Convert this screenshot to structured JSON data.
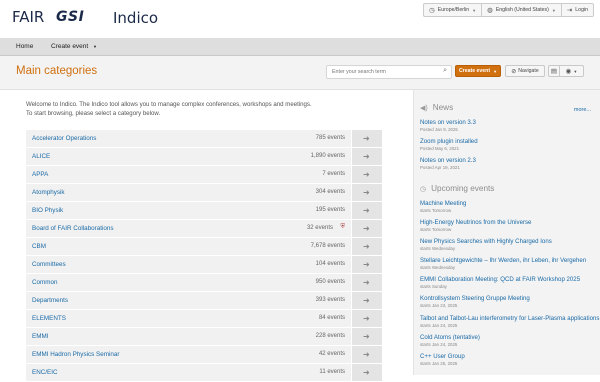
{
  "header": {
    "logo_fair": "FAIR",
    "logo_gsi": "GSI",
    "title": "Indico",
    "top_menu": {
      "timezone": "Europe/Berlin",
      "language": "English (United States)",
      "login": "Login"
    }
  },
  "nav": {
    "home": "Home",
    "create_event": "Create event"
  },
  "page": {
    "title": "Main categories",
    "search_placeholder": "Enter your search term",
    "create_event_button": "Create event",
    "navigate_button": "Navigate"
  },
  "welcome": {
    "line1": "Welcome to Indico. The Indico tool allows you to manage complex conferences, workshops and meetings.",
    "line2": "To start browsing, please select a category below."
  },
  "categories": [
    {
      "name": "Accelerator Operations",
      "count": "785 events"
    },
    {
      "name": "ALICE",
      "count": "1,890 events"
    },
    {
      "name": "APPA",
      "count": "7 events"
    },
    {
      "name": "Atomphysik",
      "count": "304 events"
    },
    {
      "name": "BIO Physik",
      "count": "195 events"
    },
    {
      "name": "Board of FAIR Collaborations",
      "count": "32 events",
      "protected": true
    },
    {
      "name": "CBM",
      "count": "7,678 events"
    },
    {
      "name": "Committees",
      "count": "104 events"
    },
    {
      "name": "Common",
      "count": "950 events"
    },
    {
      "name": "Departments",
      "count": "393 events"
    },
    {
      "name": "ELEMENTS",
      "count": "84 events"
    },
    {
      "name": "EMMI",
      "count": "228 events"
    },
    {
      "name": "EMMI Hadron Physics Seminar",
      "count": "42 events"
    },
    {
      "name": "ENC/EIC",
      "count": "11 events"
    }
  ],
  "news": {
    "heading": "News",
    "more": "more...",
    "items": [
      {
        "title": "Notes on version 3.3",
        "date": "Posted Jan 9, 2025"
      },
      {
        "title": "Zoom plugin installed",
        "date": "Posted May 6, 2021"
      },
      {
        "title": "Notes on version 2.3",
        "date": "Posted Apr 19, 2021"
      }
    ]
  },
  "upcoming": {
    "heading": "Upcoming events",
    "items": [
      {
        "title": "Machine Meeting",
        "date": "starts Tomorrow"
      },
      {
        "title": "High-Energy Neutrinos from the Universe",
        "date": "starts Tomorrow"
      },
      {
        "title": "New Physics Searches with Highly Charged Ions",
        "date": "starts Wednesday"
      },
      {
        "title": "Stellare Leichtgewichte – Ihr Werden, ihr Leben, ihr Vergehen",
        "date": "starts Wednesday"
      },
      {
        "title": "EMMI Collaboration Meeting: QCD at FAIR Workshop 2025",
        "date": "starts Sunday"
      },
      {
        "title": "Kontrollsystem Steering Gruppe Meeting",
        "date": "starts Jan 23, 2025"
      },
      {
        "title": "Talbot and Talbot-Lau interferometry for Laser-Plasma applications",
        "date": "starts Jan 24, 2025"
      },
      {
        "title": "Cold Atoms (tentative)",
        "date": "starts Jan 24, 2025"
      },
      {
        "title": "C++ User Group",
        "date": "starts Jan 25, 2025"
      }
    ]
  }
}
